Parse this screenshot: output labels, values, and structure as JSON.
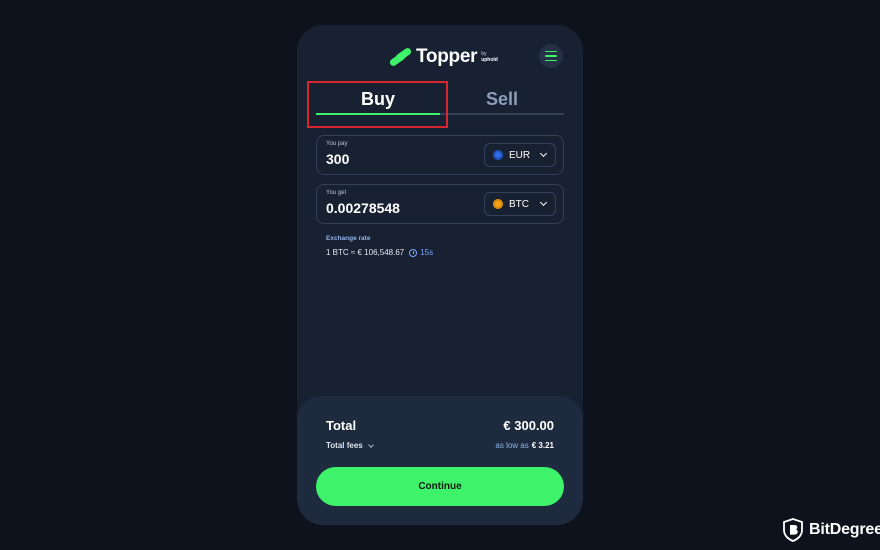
{
  "app": {
    "brand_name": "Topper",
    "brand_by": "by",
    "brand_parent": "uphold"
  },
  "tabs": [
    {
      "label": "Buy",
      "active": true
    },
    {
      "label": "Sell",
      "active": false
    }
  ],
  "pay": {
    "label": "You pay",
    "value": "300",
    "currency": "EUR",
    "coin_icon": "euro-coin-icon"
  },
  "get": {
    "label": "You get",
    "value": "0.00278548",
    "currency": "BTC",
    "coin_icon": "bitcoin-coin-icon"
  },
  "rate": {
    "label": "Exchange rate",
    "text": "1 BTC ≈ € 106,548.67",
    "timer": "15s"
  },
  "summary": {
    "total_label": "Total",
    "total_value": "€ 300.00",
    "fees_label": "Total fees",
    "fees_prefix": "as low as",
    "fees_amount": "€ 3.21"
  },
  "actions": {
    "continue_label": "Continue"
  },
  "watermark": {
    "text": "BitDegree"
  },
  "colors": {
    "accent": "#3ef26a",
    "panel": "#182131",
    "background": "#0d121c",
    "highlight": "#d8262e"
  }
}
